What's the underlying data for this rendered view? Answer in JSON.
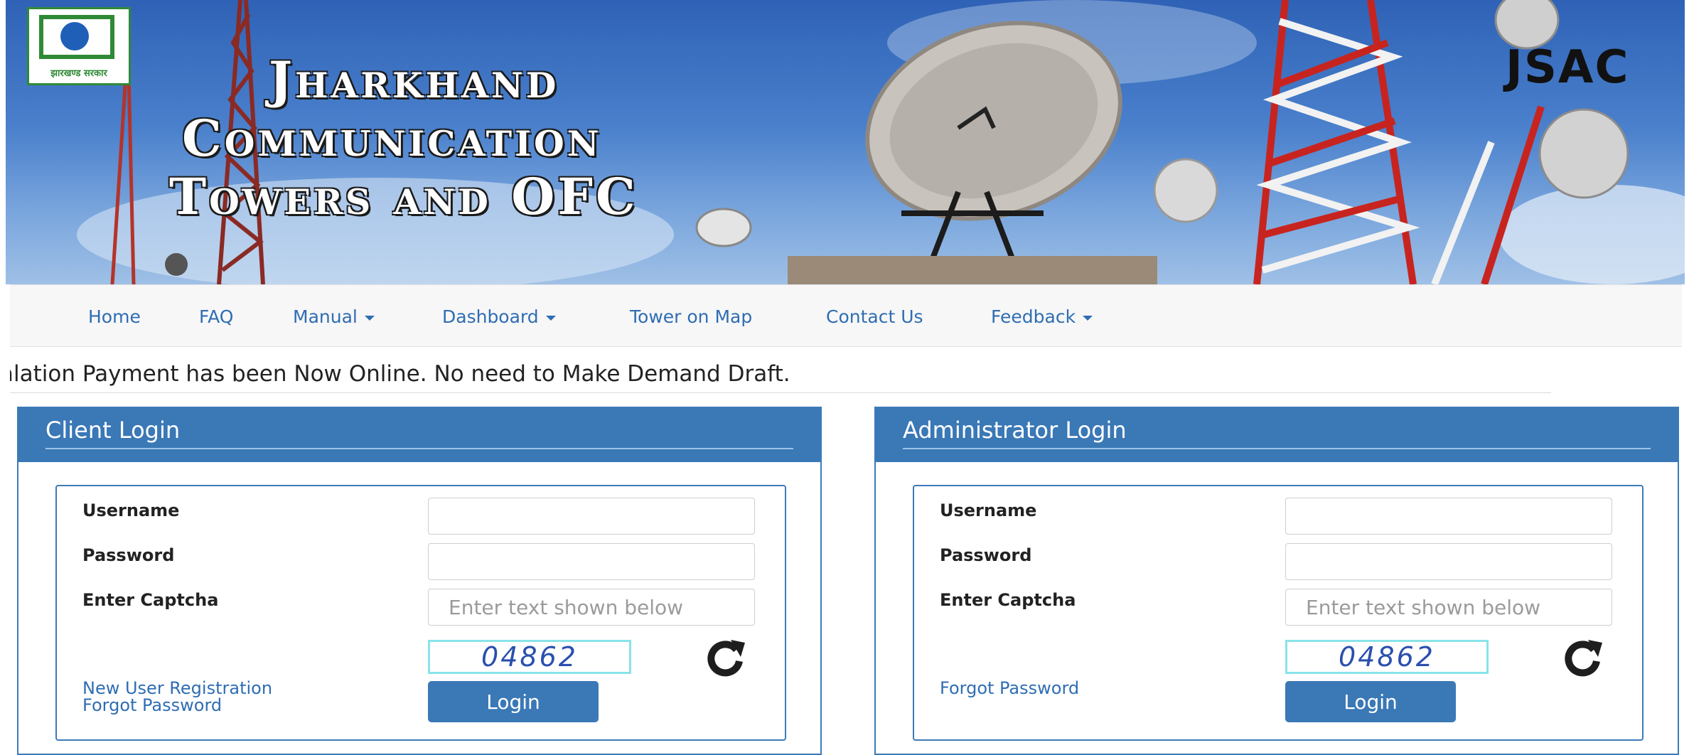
{
  "banner": {
    "title_line1": "Jharkhand",
    "title_line2": "Communication",
    "title_line3": "Towers and OFC",
    "emblem_text": "झारखण्ड सरकार",
    "brand": "JSAC"
  },
  "nav": {
    "items": [
      "Home",
      "FAQ",
      "Manual",
      "Dashboard",
      "Tower on Map",
      "Contact Us",
      "Feedback"
    ]
  },
  "notice": {
    "text": "alation Payment has been Now Online. No need to Make Demand Draft."
  },
  "client_login": {
    "title": "Client Login",
    "username_label": "Username",
    "password_label": "Password",
    "captcha_label": "Enter Captcha",
    "captcha_placeholder": "Enter text shown below",
    "captcha_code": "04862",
    "new_user_link": "New User Registration",
    "forgot_link": "Forgot Password",
    "login_button": "Login"
  },
  "admin_login": {
    "title": "Administrator Login",
    "username_label": "Username",
    "password_label": "Password",
    "captcha_label": "Enter Captcha",
    "captcha_placeholder": "Enter text shown below",
    "captcha_code": "04862",
    "forgot_link": "Forgot Password",
    "login_button": "Login"
  },
  "colors": {
    "panel_header": "#3a78b6",
    "nav_link": "#2f6db3",
    "captcha_border": "#89e3ea"
  }
}
